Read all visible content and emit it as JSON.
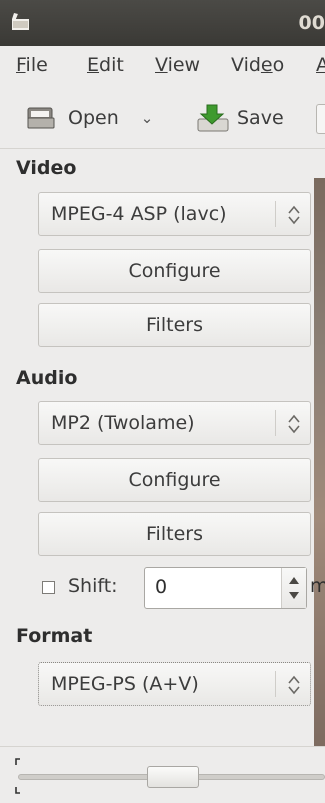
{
  "window": {
    "title": "00"
  },
  "menu": [
    {
      "pre": "",
      "u": "F",
      "post": "ile"
    },
    {
      "pre": "",
      "u": "E",
      "post": "dit"
    },
    {
      "pre": "",
      "u": "V",
      "post": "iew"
    },
    {
      "pre": "Vid",
      "u": "e",
      "post": "o"
    },
    {
      "pre": "",
      "u": "A",
      "post": ""
    }
  ],
  "toolbar": {
    "open_label": "Open",
    "open_arrow": "⌄",
    "save_label": "Save"
  },
  "video": {
    "heading": "Video",
    "codec": "MPEG-4 ASP (lavc)",
    "configure_label": "Configure",
    "filters_label": "Filters"
  },
  "audio": {
    "heading": "Audio",
    "codec": "MP2 (Twolame)",
    "configure_label": "Configure",
    "filters_label": "Filters",
    "shift_label": "Shift:",
    "shift_checked": false,
    "shift_value": "0",
    "shift_unit": "ms"
  },
  "format": {
    "heading": "Format",
    "container": "MPEG-PS (A+V)"
  },
  "icons": {
    "app": "clapperboard-icon",
    "open": "folder-open-icon",
    "save": "save-download-icon",
    "combo_arrows": "updown-arrows-icon",
    "spin_arrows": "spin-arrows-icon"
  },
  "colors": {
    "titlebar": "#3f3e3a",
    "window_bg": "#edeceb",
    "title_text": "#dfdbd2"
  }
}
